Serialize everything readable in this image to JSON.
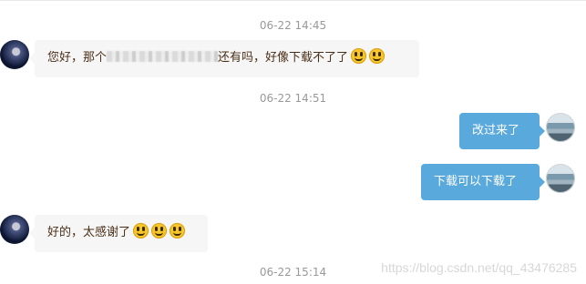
{
  "messages": [
    {
      "type": "timestamp",
      "text": "06-22 14:45"
    },
    {
      "type": "received",
      "prefix": "您好，那个",
      "suffix": "还有吗，好像下载不了了",
      "emojis": 2
    },
    {
      "type": "timestamp",
      "text": "06-22 14:51"
    },
    {
      "type": "sent",
      "text": "改过来了"
    },
    {
      "type": "sent",
      "text": "下载可以下载了"
    },
    {
      "type": "received",
      "text": "好的，太感谢了",
      "emojis": 3
    },
    {
      "type": "timestamp",
      "text": "06-22 15:14"
    }
  ],
  "watermark": "https://blog.csdn.net/qq_43476285",
  "colors": {
    "sent_bubble": "#5aa9dc",
    "received_bubble": "#f6f6f6",
    "timestamp": "#999999"
  },
  "icons": {
    "emoji": "grinning-face-icon"
  }
}
